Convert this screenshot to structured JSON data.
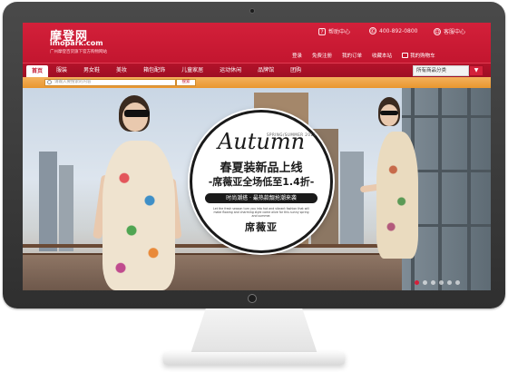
{
  "site": {
    "logo_text": "摩登网",
    "logo_domain": "imopark.com",
    "logo_tagline": "广州摩登百货旗下官方购物网站"
  },
  "header_utils": {
    "help": "帮助中心",
    "phone": "400-892-0800",
    "service": "客服中心"
  },
  "header_links": [
    "登录",
    "免费注册",
    "我的订单",
    "收藏本站",
    "我的购物车"
  ],
  "nav": {
    "items": [
      "首页",
      "服装",
      "男女鞋",
      "美妆",
      "箱包配饰",
      "儿童家居",
      "运动休闲",
      "品牌馆",
      "团购"
    ],
    "category_select": "所有商品分类",
    "category_arrow": "▼"
  },
  "search": {
    "placeholder": "请输入要搜索的内容",
    "button": "搜索"
  },
  "promo": {
    "script": "Autumn",
    "season": "SPRING/SUMMER 2015",
    "title": "春夏装新品上线",
    "sale": "-席薇亚全场低至1.4折-",
    "pill": "时尚潮搭 · 最热款靓抢潮来袭",
    "fine": "Let the fresh season turn you into hot and vibrant fashion that will make flowing and charming style come alive for this sunny spring and summer.",
    "brand": "席薇亚"
  },
  "carousel": {
    "slides": 6,
    "active": 0
  },
  "colors": {
    "brand_red": "#c3162f",
    "search_orange": "#e9962f"
  }
}
